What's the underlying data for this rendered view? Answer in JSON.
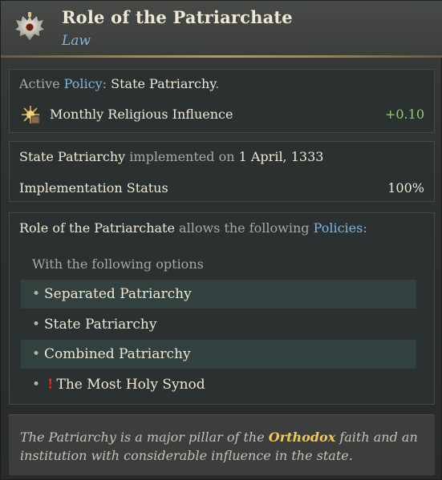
{
  "header": {
    "title": "Role of the Patriarchate",
    "subtitle": "Law",
    "emblem_icon": "double-headed-eagle-icon"
  },
  "policy": {
    "prefix": "Active",
    "policy_word": "Policy",
    "colon": ":",
    "name": "State Patriarchy",
    "period": ".",
    "modifier_icon": "religious-influence-icon",
    "modifier_label": "Monthly Religious Influence",
    "modifier_value": "+0.10"
  },
  "implementation": {
    "policy_name": "State Patriarchy",
    "text_mid": "implemented on",
    "date": "1 April, 1333",
    "status_label": "Implementation Status",
    "status_value": "100%"
  },
  "allows": {
    "law_name": "Role of the Patriarchate",
    "text_mid": "allows the following",
    "policies_word": "Policies",
    "colon": ":",
    "options_heading": "With the following options",
    "options": [
      "Separated Patriarchy",
      "State Patriarchy",
      "Combined Patriarchy",
      "The Most Holy Synod"
    ],
    "warning_symbol": "!"
  },
  "flavor": {
    "part1": "The Patriarchy is a major pillar of the",
    "highlight": "Orthodox",
    "part2": "faith and an institution with considerable influence in the state."
  },
  "colors": {
    "accent_blue": "#7fb6e0",
    "positive_green": "#8fce6b",
    "gold_rule": "#b89a58",
    "warning_red": "#e03131"
  }
}
